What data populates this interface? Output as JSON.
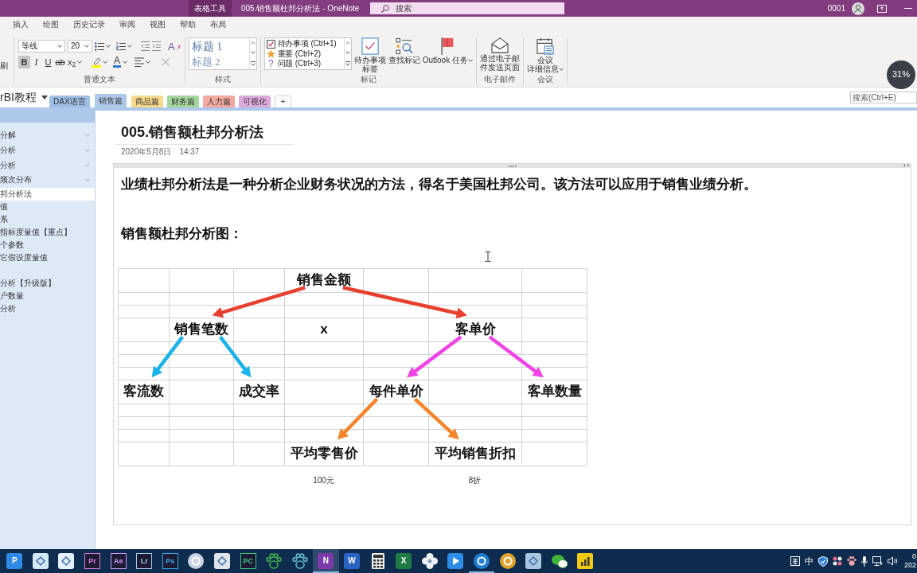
{
  "title_bar": {
    "contextual_tab": "表格工具",
    "title": "005.销售额杜邦分析法 - OneNote",
    "search": {
      "placeholder": "搜索"
    },
    "account": "0001"
  },
  "ribbon": {
    "tabs": [
      {
        "label": "插入",
        "selected": false
      },
      {
        "label": "绘图",
        "selected": false
      },
      {
        "label": "历史记录",
        "selected": false
      },
      {
        "label": "审阅",
        "selected": false
      },
      {
        "label": "视图",
        "selected": false
      },
      {
        "label": "帮助",
        "selected": false
      },
      {
        "label": "布局",
        "selected": false
      }
    ],
    "clipped_label": "刷",
    "basic_text": {
      "label": "普通文本",
      "font": "等线",
      "size": "20",
      "formats": [
        {
          "kind": "bold",
          "label": "B",
          "selected": true
        },
        {
          "kind": "italic",
          "label": "I",
          "selected": false
        },
        {
          "kind": "underline",
          "label": "U",
          "selected": false
        },
        {
          "kind": "strikethrough",
          "label": "ab",
          "selected": false
        },
        {
          "kind": "subscript",
          "label": "x$_{2}$",
          "selected": false
        }
      ],
      "font_color": "A",
      "clear_formatting": "A",
      "delete_disabled": true
    },
    "styles": {
      "label": "样式",
      "items": [
        "标题 1",
        "标题 2"
      ]
    },
    "tags": {
      "label": "标记",
      "items": [
        {
          "kind": "todo",
          "label": "待办事项 (Ctrl+1)"
        },
        {
          "kind": "important",
          "label": "重要 (Ctrl+2)"
        },
        {
          "kind": "question",
          "symbol": "?",
          "label": "问题 (Ctrl+3)"
        }
      ],
      "buttons": [
        {
          "kind": "todo-tag",
          "lines": [
            "待办事项",
            "标签"
          ],
          "menu": false
        },
        {
          "kind": "find-tags",
          "lines": [
            "查找标记"
          ],
          "menu": false
        },
        {
          "kind": "outlook-task",
          "lines": [
            "Outlook 任务"
          ],
          "menu": true
        }
      ]
    },
    "email": {
      "label": "电子邮件",
      "button": {
        "lines": [
          "通过电子邮",
          "件发送页面"
        ]
      }
    },
    "meeting": {
      "label": "会议",
      "button": {
        "lines": [
          "会议",
          "详细信息"
        ],
        "menu": true
      }
    }
  },
  "notebook_bar": {
    "notebook": "rBI教程",
    "sections": [
      {
        "label": "DAX语言",
        "color": "#9fbee6",
        "selected": false
      },
      {
        "label": "销售篇",
        "color": "#aec8ea",
        "selected": true
      },
      {
        "label": "商品篇",
        "color": "#f7d98c",
        "selected": false
      },
      {
        "label": "财务篇",
        "color": "#a3d59c",
        "selected": false
      },
      {
        "label": "人力篇",
        "color": "#f2a9a2",
        "selected": false
      },
      {
        "label": "可视化",
        "color": "#dcabdb",
        "selected": false
      }
    ],
    "add_section": "+",
    "search": {
      "placeholder": "搜索(Ctrl+E)"
    }
  },
  "overlay_widget": {
    "text": "31%"
  },
  "pages": [
    {
      "kind": "page",
      "title": "分解",
      "selected": false,
      "collapsible": true
    },
    {
      "kind": "page",
      "title": "分析",
      "selected": false,
      "collapsible": true
    },
    {
      "kind": "page",
      "title": "分析",
      "selected": false,
      "collapsible": true
    },
    {
      "kind": "page",
      "title": "频次分布",
      "selected": false,
      "collapsible": true
    },
    {
      "kind": "page",
      "title": "邦分析法",
      "selected": true,
      "collapsible": false
    },
    {
      "kind": "page",
      "title": "值",
      "selected": false,
      "collapsible": false
    },
    {
      "kind": "page",
      "title": "系",
      "selected": false,
      "collapsible": false
    },
    {
      "kind": "page",
      "title": "指标度量值【重点】",
      "selected": false,
      "collapsible": false
    },
    {
      "kind": "page",
      "title": "个参数",
      "selected": false,
      "collapsible": false
    },
    {
      "kind": "page",
      "title": "它假设度量值",
      "selected": false,
      "collapsible": false
    },
    {
      "kind": "blank"
    },
    {
      "kind": "page",
      "title": "分析【升级版】",
      "selected": false,
      "collapsible": false
    },
    {
      "kind": "page",
      "title": "户数量",
      "selected": false,
      "collapsible": false
    },
    {
      "kind": "page",
      "title": "分析",
      "selected": false,
      "collapsible": false
    }
  ],
  "page": {
    "title": "005.销售额杜邦分析法",
    "date": "2020年5月8日",
    "time": "14:37",
    "paragraphs": [
      "业绩杜邦分析法是一种分析企业财务状况的方法，得名于美国杜邦公司。该方法可以应用于销售业绩分析。",
      "销售额杜邦分析图："
    ],
    "table": {
      "rows": [
        [
          null,
          null,
          null,
          {
            "text": "销售金额",
            "arrows": {
              "color": "#e8402e",
              "left": true,
              "right": true
            }
          },
          null,
          null,
          null
        ],
        [
          null,
          null,
          null,
          null,
          null,
          null,
          null
        ],
        [
          null,
          null,
          null,
          null,
          null,
          null,
          null
        ],
        [
          null,
          {
            "text": "销售笔数",
            "arrows": {
              "color": "#1ab2ea",
              "left": true,
              "right": true
            }
          },
          null,
          {
            "text": "x"
          },
          null,
          {
            "text": "客单价",
            "arrows": {
              "color": "#f044e6",
              "left": true,
              "right": true
            }
          },
          null
        ],
        [
          null,
          null,
          null,
          null,
          null,
          null,
          null
        ],
        [
          null,
          null,
          null,
          null,
          null,
          null,
          null
        ],
        [
          null,
          null,
          null,
          null,
          null,
          null,
          null
        ],
        [
          {
            "text": "客流数"
          },
          null,
          {
            "text": "成交率"
          },
          null,
          {
            "text": "每件单价",
            "arrows": {
              "color": "#f5842a",
              "left": true,
              "right": true
            }
          },
          null,
          {
            "text": "客单数量"
          }
        ],
        [
          null,
          null,
          null,
          null,
          null,
          null,
          null
        ],
        [
          null,
          null,
          null,
          null,
          null,
          null,
          null
        ],
        [
          null,
          null,
          null,
          null,
          null,
          null,
          null
        ],
        [
          null,
          null,
          null,
          {
            "text": "平均零售价",
            "note": "100元"
          },
          null,
          {
            "text": "平均销售折扣",
            "note": "8折"
          },
          null
        ]
      ]
    }
  },
  "taskbar": {
    "apps": [
      {
        "kind": "tile",
        "glyph": "P",
        "color": "#2f8ae6",
        "active": false,
        "running": false
      },
      {
        "kind": "tile",
        "color": "#d4e8f8",
        "active": false,
        "running": false
      },
      {
        "kind": "tile",
        "color": "#e4f1fb",
        "active": false,
        "running": false
      },
      {
        "kind": "framed",
        "glyph": "Pr",
        "color": "#d77be0",
        "active": false,
        "running": false
      },
      {
        "kind": "framed",
        "glyph": "Ae",
        "color": "#c59af2",
        "active": false,
        "running": false
      },
      {
        "kind": "framed",
        "glyph": "Lr",
        "color": "#a6cde8",
        "active": false,
        "running": false
      },
      {
        "kind": "framed",
        "glyph": "Ps",
        "color": "#3aa2e8",
        "active": false,
        "running": false
      },
      {
        "kind": "disc",
        "color": "#c9d3e3",
        "active": false,
        "running": false
      },
      {
        "kind": "tile",
        "color": "#dfe4ea",
        "active": false,
        "running": false
      },
      {
        "kind": "framed",
        "glyph": "PC",
        "color": "#3cc77e",
        "active": false,
        "running": false
      },
      {
        "kind": "paw",
        "color": "#3fae4e",
        "active": false,
        "running": false
      },
      {
        "kind": "paw",
        "color": "#63b6cc",
        "active": false,
        "running": false
      },
      {
        "kind": "tile",
        "glyph": "N",
        "color": "#7b3aa8",
        "active": true,
        "running": true
      },
      {
        "kind": "tile",
        "glyph": "W",
        "color": "#2b63c4",
        "active": false,
        "running": false
      },
      {
        "kind": "calculator",
        "color": "#f2f2f2",
        "active": false,
        "running": false
      },
      {
        "kind": "tile",
        "glyph": "X",
        "color": "#1f7a45",
        "active": false,
        "running": false
      },
      {
        "kind": "flower",
        "color": "#eef2f6",
        "active": false,
        "running": false
      },
      {
        "kind": "play",
        "color": "#2d8de8",
        "active": false,
        "running": false
      },
      {
        "kind": "disc",
        "color": "#1f7fd6",
        "active": false,
        "running": true
      },
      {
        "kind": "disc",
        "color": "#e0a22a",
        "active": false,
        "running": false
      },
      {
        "kind": "tile",
        "color": "#a8c6de",
        "active": false,
        "running": false
      },
      {
        "kind": "chat",
        "color": "#43b53a",
        "active": false,
        "running": false
      },
      {
        "kind": "bars",
        "color": "#f2c811",
        "active": false,
        "running": false
      }
    ],
    "tray": {
      "ime": "中",
      "clock_time": "0",
      "clock_date": "202"
    }
  }
}
